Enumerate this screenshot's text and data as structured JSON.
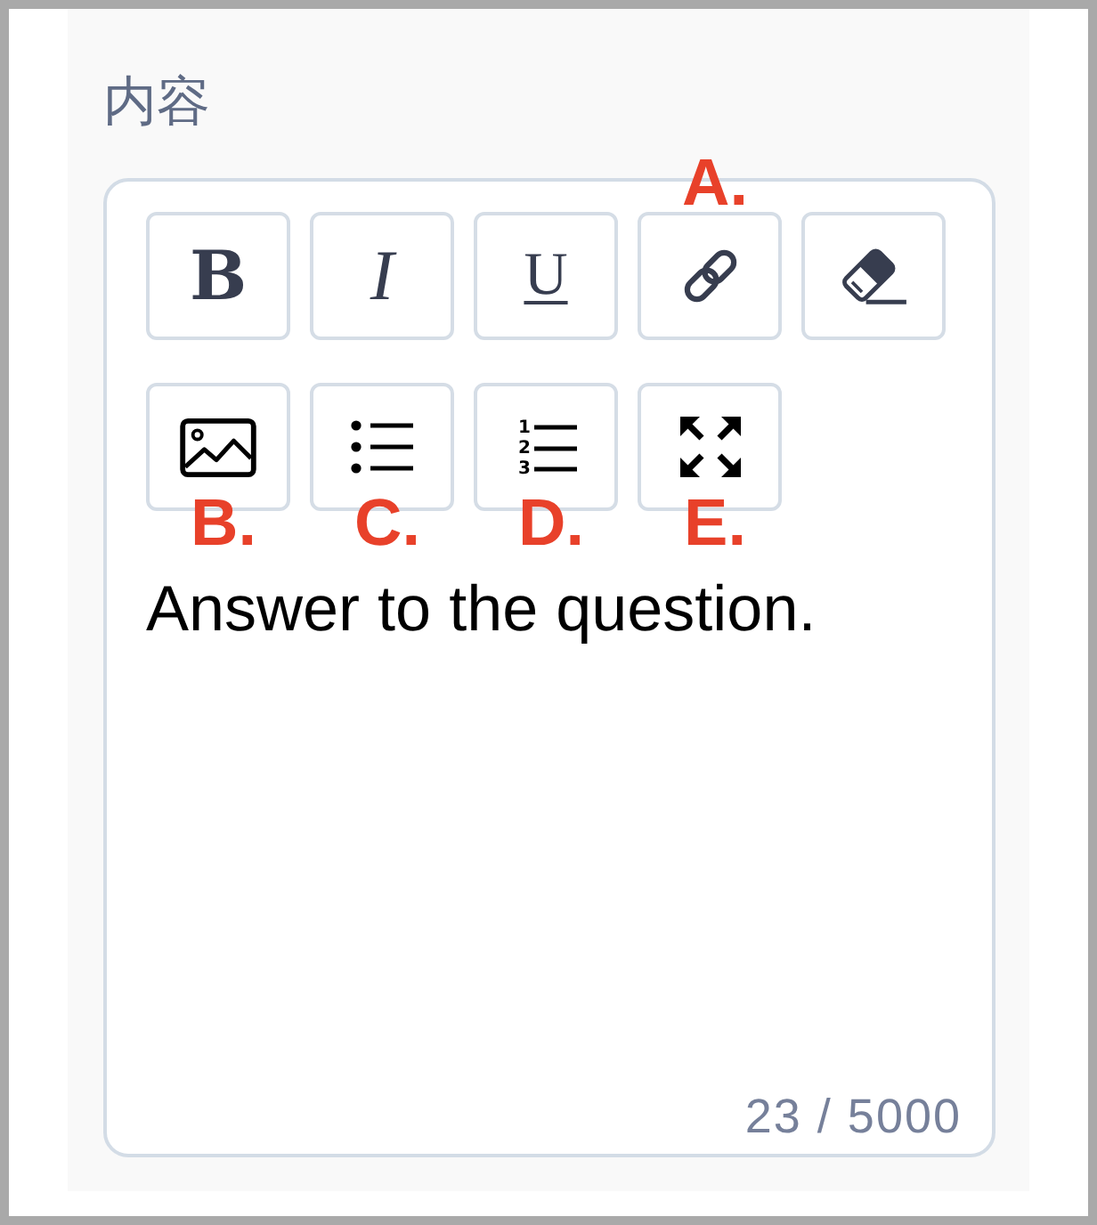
{
  "field": {
    "label": "内容",
    "editor": {
      "toolbar_rows": [
        {
          "buttons": [
            {
              "kind": "bold",
              "label": "B"
            },
            {
              "kind": "italic",
              "label": "I"
            },
            {
              "kind": "underline",
              "label": "U"
            },
            {
              "kind": "link",
              "annotation": "A."
            },
            {
              "kind": "clear-format"
            }
          ]
        },
        {
          "buttons": [
            {
              "kind": "image",
              "annotation": "B."
            },
            {
              "kind": "bullet-list",
              "annotation": "C."
            },
            {
              "kind": "numbered-list",
              "markers": [
                "1",
                "2",
                "3"
              ],
              "annotation": "D."
            },
            {
              "kind": "fullscreen",
              "annotation": "E."
            }
          ]
        }
      ],
      "value": "Answer to the question.",
      "counter": "23 / 5000"
    }
  }
}
